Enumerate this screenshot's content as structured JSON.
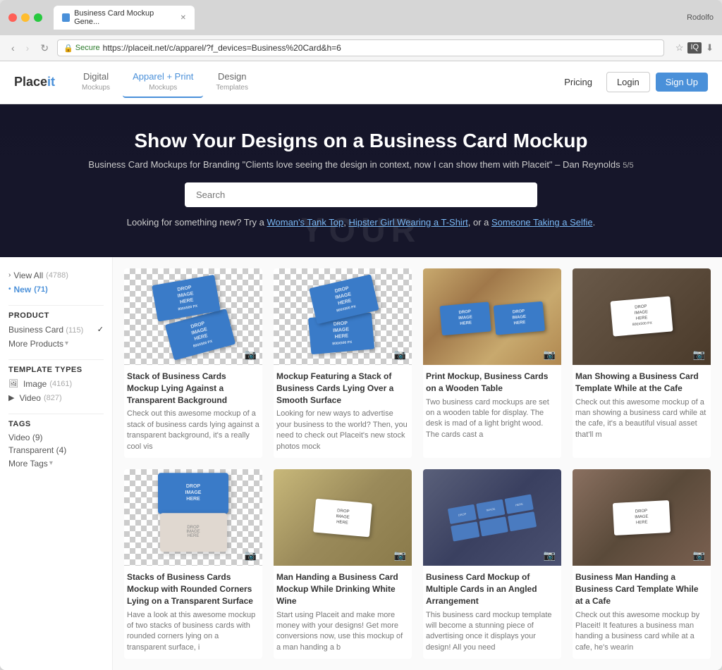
{
  "browser": {
    "tab_title": "Business Card Mockup Gene...",
    "address": "https://placeit.net/c/apparel/?f_devices=Business%20Card&h=6",
    "user": "Rodolfo",
    "secure_label": "Secure"
  },
  "header": {
    "logo": "Placeit",
    "nav": [
      {
        "id": "digital",
        "label": "Digital",
        "sub": "Mockups",
        "active": false
      },
      {
        "id": "apparel",
        "label": "Apparel + Print",
        "sub": "Mockups",
        "active": true
      },
      {
        "id": "design",
        "label": "Design",
        "sub": "Templates",
        "active": false
      }
    ],
    "pricing_label": "Pricing",
    "login_label": "Login",
    "signup_label": "Sign Up"
  },
  "hero": {
    "title": "Show Your Designs on a Business Card Mockup",
    "subtitle": "Business Card Mockups for Branding \"Clients love seeing the design in context, now I can show them with Placeit\" – Dan Reynolds",
    "subtitle_suffix": "5/5",
    "search_placeholder": "Search",
    "suggestion": "Looking for something new? Try a",
    "links": [
      "Woman's Tank Top",
      "Hipster Girl Wearing a T-Shirt",
      "Someone Taking a Selfie"
    ],
    "watermark": "YOUR"
  },
  "sidebar": {
    "view_all_label": "View All",
    "view_all_count": "(4788)",
    "new_label": "New",
    "new_count": "(71)",
    "product_label": "Product",
    "business_card_label": "Business Card",
    "business_card_count": "(115)",
    "more_products_label": "More Products",
    "template_types_label": "Template Types",
    "image_label": "Image",
    "image_count": "(4161)",
    "video_label": "Video",
    "video_count": "(827)",
    "tags_label": "Tags",
    "tag_video_label": "Video",
    "tag_video_count": "(9)",
    "tag_transparent_label": "Transparent",
    "tag_transparent_count": "(4)",
    "more_tags_label": "More Tags"
  },
  "cards": [
    {
      "id": "card-1",
      "title": "Stack of Business Cards Mockup Lying Against a Transparent Background",
      "desc": "Check out this awesome mockup of a stack of business cards lying against a transparent background, it's a really cool vis",
      "bg": "checkerboard",
      "card_color": "blue"
    },
    {
      "id": "card-2",
      "title": "Mockup Featuring a Stack of Business Cards Lying Over a Smooth Surface",
      "desc": "Looking for new ways to advertise your business to the world? Then, you need to check out Placeit's new stock photos mock",
      "bg": "checkerboard",
      "card_color": "blue"
    },
    {
      "id": "card-3",
      "title": "Print Mockup, Business Cards on a Wooden Table",
      "desc": "Two business card mockups are set on a wooden table for display. The desk is mad of a light bright wood. The cards cast a",
      "bg": "wood",
      "card_color": "blue"
    },
    {
      "id": "card-4",
      "title": "Man Showing a Business Card Template While at the Cafe",
      "desc": "Check out this awesome mockup of a man showing a business card while at the cafe, it's a beautiful visual asset that'll m",
      "bg": "cafe",
      "card_color": "white"
    },
    {
      "id": "card-5",
      "title": "Stacks of Business Cards Mockup with Rounded Corners Lying on a Transparent Surface",
      "desc": "Have a look at this awesome mockup of two stacks of business cards with rounded corners lying on a transparent surface, i",
      "bg": "stacked",
      "card_color": "blue-stacked"
    },
    {
      "id": "card-6",
      "title": "Man Handing a Business Card Mockup While Drinking White Wine",
      "desc": "Start using Placeit and make more money with your designs! Get more conversions now, use this mockup of a man handing a b",
      "bg": "wine",
      "card_color": "white"
    },
    {
      "id": "card-7",
      "title": "Business Card Mockup of Multiple Cards in an Angled Arrangement",
      "desc": "This business card mockup template will become a stunning piece of advertising once it displays your design! All you need",
      "bg": "angled",
      "card_color": "blue-multi"
    },
    {
      "id": "card-8",
      "title": "Business Man Handing a Business Card Template While at a Cafe",
      "desc": "Check out this awesome mockup by Placeit! It features a business man handing a business card while at a cafe, he's wearin",
      "bg": "cafe2",
      "card_color": "white"
    }
  ],
  "drop_image_text": "DROP\nIMAGE\nHERE\n800X500 PX",
  "colors": {
    "accent": "#4a90d9",
    "hero_bg": "#1a1a2e",
    "card_blue": "#3a7bc8"
  }
}
